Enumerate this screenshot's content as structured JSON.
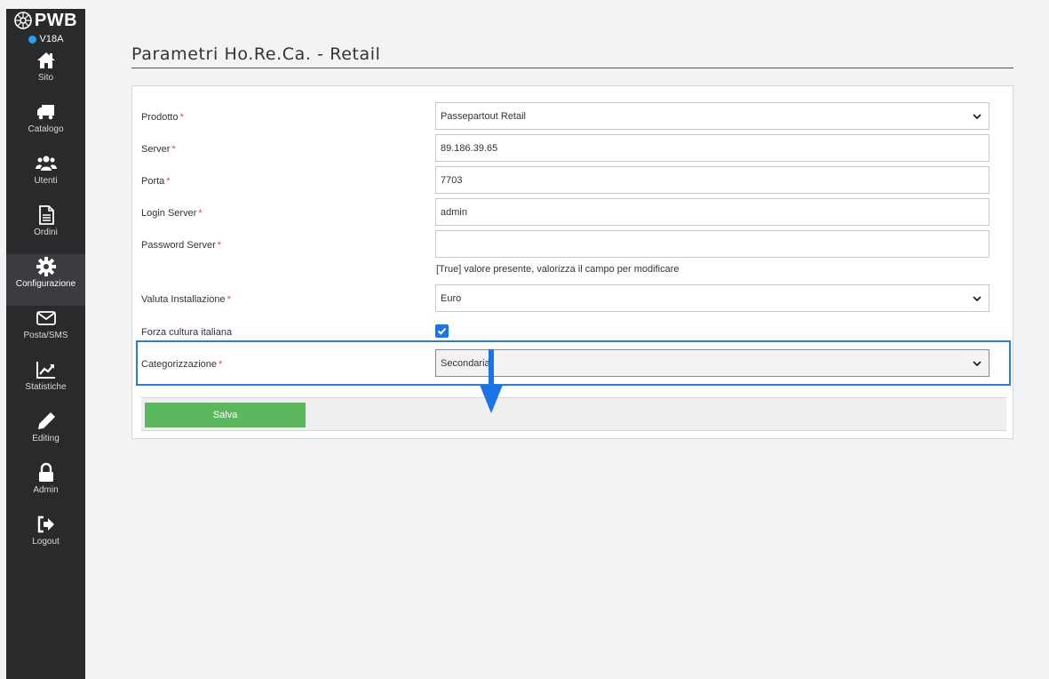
{
  "sidebar": {
    "logo": "PWB",
    "version": "V18A",
    "items": [
      {
        "label": "Sito",
        "icon": "home-icon"
      },
      {
        "label": "Catalogo",
        "icon": "truck-icon"
      },
      {
        "label": "Utenti",
        "icon": "users-icon"
      },
      {
        "label": "Ordini",
        "icon": "document-icon"
      },
      {
        "label": "Configurazione",
        "icon": "gear-icon",
        "active": true
      },
      {
        "label": "Posta/SMS",
        "icon": "envelope-icon"
      },
      {
        "label": "Statistiche",
        "icon": "chart-line-icon"
      },
      {
        "label": "Editing",
        "icon": "pencil-icon"
      },
      {
        "label": "Admin",
        "icon": "lock-icon"
      },
      {
        "label": "Logout",
        "icon": "logout-icon"
      }
    ]
  },
  "page": {
    "title": "Parametri Ho.Re.Ca. - Retail"
  },
  "form": {
    "prodotto": {
      "label": "Prodotto",
      "required": "*",
      "value": "Passepartout Retail"
    },
    "server": {
      "label": "Server",
      "required": "*",
      "value": "89.186.39.65"
    },
    "porta": {
      "label": "Porta",
      "required": "*",
      "value": "7703"
    },
    "login_server": {
      "label": "Login Server",
      "required": "*",
      "value": "admin"
    },
    "password_server": {
      "label": "Password Server",
      "required": "*",
      "value": "",
      "hint": "[True] valore presente, valorizza il campo per modificare"
    },
    "valuta": {
      "label": "Valuta Installazione",
      "required": "*",
      "value": "Euro"
    },
    "forza_cultura": {
      "label": "Forza cultura italiana",
      "checked": true
    },
    "categorizzazione": {
      "label": "Categorizzazione",
      "required": "*",
      "value": "Secondaria"
    },
    "save_label": "Salva"
  },
  "colors": {
    "sidebar_bg": "#292a2c",
    "accent_blue": "#1a73e8",
    "save_green": "#5cb85c",
    "required_red": "#e04a4a"
  }
}
